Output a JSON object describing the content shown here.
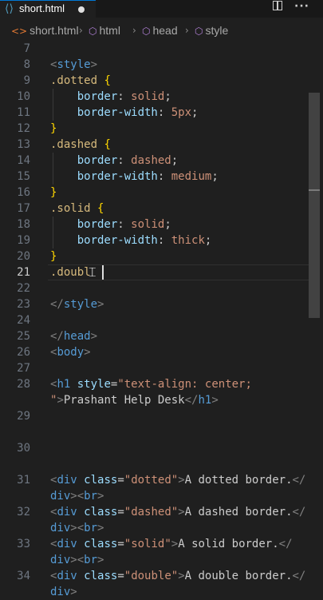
{
  "tab": {
    "icon": "code-file-icon",
    "filename": "short.html",
    "modified": true
  },
  "actions": [
    "split-editor-icon",
    "more-actions-icon"
  ],
  "breadcrumb": [
    {
      "label": "short.html",
      "icon": "html-file-icon"
    },
    {
      "label": "html",
      "icon": "element-cube-icon"
    },
    {
      "label": "head",
      "icon": "element-cube-icon"
    },
    {
      "label": "style",
      "icon": "element-cube-icon"
    }
  ],
  "editor": {
    "active_line": 21,
    "lines": [
      {
        "n": "7",
        "tokens": []
      },
      {
        "n": "8",
        "tokens": [
          [
            "t-ang",
            "<"
          ],
          [
            "t-tag",
            "style"
          ],
          [
            "t-ang",
            ">"
          ]
        ]
      },
      {
        "n": "9",
        "tokens": [
          [
            "t-sel",
            ".dotted"
          ],
          [
            "t-punc",
            " "
          ],
          [
            "t-brace",
            "{"
          ]
        ]
      },
      {
        "n": "10",
        "tokens": [
          [
            "t-punc",
            "    "
          ],
          [
            "t-prop",
            "border"
          ],
          [
            "t-punc",
            ": "
          ],
          [
            "t-val",
            "solid"
          ],
          [
            "t-punc",
            ";"
          ]
        ]
      },
      {
        "n": "11",
        "tokens": [
          [
            "t-punc",
            "    "
          ],
          [
            "t-prop",
            "border-width"
          ],
          [
            "t-punc",
            ": "
          ],
          [
            "t-val",
            "5px"
          ],
          [
            "t-punc",
            ";"
          ]
        ]
      },
      {
        "n": "12",
        "tokens": [
          [
            "t-brace",
            "}"
          ]
        ]
      },
      {
        "n": "13",
        "tokens": [
          [
            "t-sel",
            ".dashed"
          ],
          [
            "t-punc",
            " "
          ],
          [
            "t-brace",
            "{"
          ]
        ]
      },
      {
        "n": "14",
        "tokens": [
          [
            "t-punc",
            "    "
          ],
          [
            "t-prop",
            "border"
          ],
          [
            "t-punc",
            ": "
          ],
          [
            "t-val",
            "dashed"
          ],
          [
            "t-punc",
            ";"
          ]
        ]
      },
      {
        "n": "15",
        "tokens": [
          [
            "t-punc",
            "    "
          ],
          [
            "t-prop",
            "border-width"
          ],
          [
            "t-punc",
            ": "
          ],
          [
            "t-val",
            "medium"
          ],
          [
            "t-punc",
            ";"
          ]
        ]
      },
      {
        "n": "16",
        "tokens": [
          [
            "t-brace",
            "}"
          ]
        ]
      },
      {
        "n": "17",
        "tokens": [
          [
            "t-sel",
            ".solid"
          ],
          [
            "t-punc",
            " "
          ],
          [
            "t-brace",
            "{"
          ]
        ]
      },
      {
        "n": "18",
        "tokens": [
          [
            "t-punc",
            "    "
          ],
          [
            "t-prop",
            "border"
          ],
          [
            "t-punc",
            ": "
          ],
          [
            "t-val",
            "solid"
          ],
          [
            "t-punc",
            ";"
          ]
        ]
      },
      {
        "n": "19",
        "tokens": [
          [
            "t-punc",
            "    "
          ],
          [
            "t-prop",
            "border-width"
          ],
          [
            "t-punc",
            ": "
          ],
          [
            "t-val",
            "thick"
          ],
          [
            "t-punc",
            ";"
          ]
        ]
      },
      {
        "n": "20",
        "tokens": [
          [
            "t-brace",
            "}"
          ]
        ]
      },
      {
        "n": "21",
        "tokens": [
          [
            "t-sel",
            ".doubl"
          ]
        ]
      },
      {
        "n": "22",
        "tokens": []
      },
      {
        "n": "23",
        "tokens": [
          [
            "t-ang",
            "</"
          ],
          [
            "t-tag",
            "style"
          ],
          [
            "t-ang",
            ">"
          ]
        ]
      },
      {
        "n": "24",
        "tokens": []
      },
      {
        "n": "25",
        "tokens": [
          [
            "t-ang",
            "</"
          ],
          [
            "t-tag",
            "head"
          ],
          [
            "t-ang",
            ">"
          ]
        ]
      },
      {
        "n": "26",
        "tokens": [
          [
            "t-ang",
            "<"
          ],
          [
            "t-tag",
            "body"
          ],
          [
            "t-ang",
            ">"
          ]
        ]
      },
      {
        "n": "27",
        "tokens": []
      },
      {
        "n": "28",
        "tokens": [
          [
            "t-ang",
            "<"
          ],
          [
            "t-tag",
            "h1"
          ],
          [
            "t-punc",
            " "
          ],
          [
            "t-attr",
            "style"
          ],
          [
            "t-punc",
            "="
          ],
          [
            "t-str",
            "\"text-align: center;"
          ]
        ]
      },
      {
        "n": "",
        "tokens": [
          [
            "t-str",
            "\""
          ],
          [
            "t-ang",
            ">"
          ],
          [
            "t-text",
            "Prashant Help Desk"
          ],
          [
            "t-ang",
            "</"
          ],
          [
            "t-tag",
            "h1"
          ],
          [
            "t-ang",
            ">"
          ]
        ]
      },
      {
        "n": "29",
        "tokens": []
      },
      {
        "n": "",
        "tokens": []
      },
      {
        "n": "30",
        "tokens": []
      },
      {
        "n": "",
        "tokens": []
      },
      {
        "n": "31",
        "tokens": [
          [
            "t-ang",
            "<"
          ],
          [
            "t-tag",
            "div"
          ],
          [
            "t-punc",
            " "
          ],
          [
            "t-attr",
            "class"
          ],
          [
            "t-punc",
            "="
          ],
          [
            "t-str",
            "\"dotted\""
          ],
          [
            "t-ang",
            ">"
          ],
          [
            "t-text",
            "A dotted border."
          ],
          [
            "t-ang",
            "</"
          ]
        ]
      },
      {
        "n": "",
        "tokens": [
          [
            "t-tag",
            "div"
          ],
          [
            "t-ang",
            "><"
          ],
          [
            "t-tag",
            "br"
          ],
          [
            "t-ang",
            ">"
          ]
        ]
      },
      {
        "n": "32",
        "tokens": [
          [
            "t-ang",
            "<"
          ],
          [
            "t-tag",
            "div"
          ],
          [
            "t-punc",
            " "
          ],
          [
            "t-attr",
            "class"
          ],
          [
            "t-punc",
            "="
          ],
          [
            "t-str",
            "\"dashed\""
          ],
          [
            "t-ang",
            ">"
          ],
          [
            "t-text",
            "A dashed border."
          ],
          [
            "t-ang",
            "</"
          ]
        ]
      },
      {
        "n": "",
        "tokens": [
          [
            "t-tag",
            "div"
          ],
          [
            "t-ang",
            "><"
          ],
          [
            "t-tag",
            "br"
          ],
          [
            "t-ang",
            ">"
          ]
        ]
      },
      {
        "n": "33",
        "tokens": [
          [
            "t-ang",
            "<"
          ],
          [
            "t-tag",
            "div"
          ],
          [
            "t-punc",
            " "
          ],
          [
            "t-attr",
            "class"
          ],
          [
            "t-punc",
            "="
          ],
          [
            "t-str",
            "\"solid\""
          ],
          [
            "t-ang",
            ">"
          ],
          [
            "t-text",
            "A solid border."
          ],
          [
            "t-ang",
            "</"
          ]
        ]
      },
      {
        "n": "",
        "tokens": [
          [
            "t-tag",
            "div"
          ],
          [
            "t-ang",
            "><"
          ],
          [
            "t-tag",
            "br"
          ],
          [
            "t-ang",
            ">"
          ]
        ]
      },
      {
        "n": "34",
        "tokens": [
          [
            "t-ang",
            "<"
          ],
          [
            "t-tag",
            "div"
          ],
          [
            "t-punc",
            " "
          ],
          [
            "t-attr",
            "class"
          ],
          [
            "t-punc",
            "="
          ],
          [
            "t-str",
            "\"double\""
          ],
          [
            "t-ang",
            ">"
          ],
          [
            "t-text",
            "A double border."
          ],
          [
            "t-ang",
            "</"
          ]
        ]
      },
      {
        "n": "",
        "tokens": [
          [
            "t-tag",
            "div"
          ],
          [
            "t-ang",
            ">"
          ]
        ]
      }
    ]
  },
  "colors": {
    "accent": "#0078d4",
    "editor_bg": "#1f1f1f",
    "tag": "#569cd6",
    "selector": "#d7ba7d",
    "property": "#9cdcfe",
    "value": "#ce9178",
    "brace": "#ffd700"
  }
}
